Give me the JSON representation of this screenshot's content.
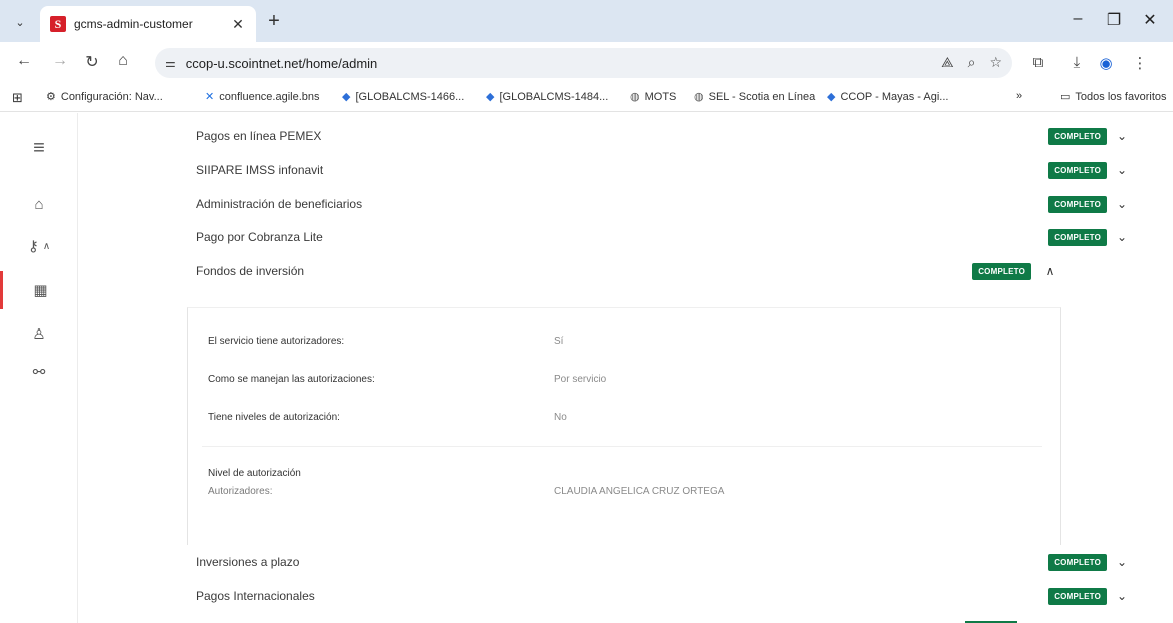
{
  "browser": {
    "tab_title": "gcms-admin-customer",
    "url": "ccop-u.scointnet.net/home/admin",
    "bookmarks": [
      {
        "label": "Configuración: Nav...",
        "icon": "gear-icon"
      },
      {
        "label": "confluence.agile.bns",
        "icon": "confluence-icon"
      },
      {
        "label": "[GLOBALCMS-1466...",
        "icon": "jira-icon"
      },
      {
        "label": "[GLOBALCMS-1484...",
        "icon": "jira-icon"
      },
      {
        "label": "MOTS",
        "icon": "globe-icon"
      },
      {
        "label": "SEL - Scotia en Línea",
        "icon": "globe-icon"
      },
      {
        "label": "CCOP - Mayas - Agi...",
        "icon": "jira-icon"
      }
    ],
    "bookmarks_overflow": "»",
    "all_bookmarks": "Todos los favoritos"
  },
  "services": [
    {
      "title": "Pagos en línea PEMEX",
      "status": "COMPLETO",
      "expanded": false
    },
    {
      "title": "SIIPARE IMSS infonavit",
      "status": "COMPLETO",
      "expanded": false
    },
    {
      "title": "Administración de beneficiarios",
      "status": "COMPLETO",
      "expanded": false
    },
    {
      "title": "Pago por Cobranza Lite",
      "status": "COMPLETO",
      "expanded": false
    },
    {
      "title": "Fondos de inversión",
      "status": "COMPLETO",
      "expanded": true
    },
    {
      "title": "Inversiones a plazo",
      "status": "COMPLETO",
      "expanded": false
    },
    {
      "title": "Pagos Internacionales",
      "status": "COMPLETO",
      "expanded": false
    }
  ],
  "detail": {
    "rows": [
      {
        "label": "El servicio tiene autorizadores:",
        "value": "Sí"
      },
      {
        "label": "Como se manejan las autorizaciones:",
        "value": "Por servicio"
      },
      {
        "label": "Tiene niveles de autorización:",
        "value": "No"
      }
    ],
    "level_heading": "Nivel de autorización",
    "authorizers_label": "Autorizadores:",
    "authorizers_value": "CLAUDIA ANGELICA CRUZ ORTEGA"
  }
}
